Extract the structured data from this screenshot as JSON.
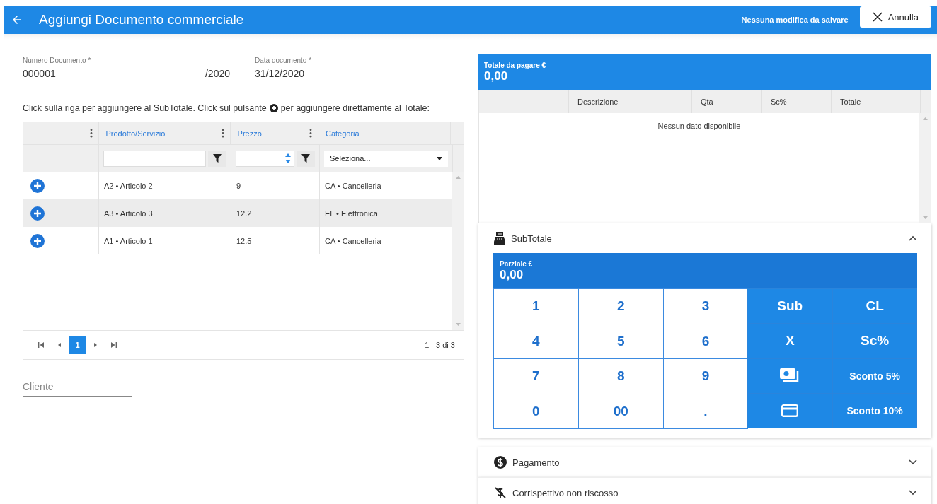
{
  "header": {
    "title": "Aggiungi Documento commerciale",
    "status": "Nessuna modifica da salvare",
    "cancel_button": "Annulla"
  },
  "fields": {
    "document_number": {
      "label": "Numero Documento *",
      "value": "000001",
      "suffix": "/2020"
    },
    "document_date": {
      "label": "Data documento *",
      "value": "31/12/2020"
    }
  },
  "instruction": {
    "before": "Click sulla riga per aggiungere al SubTotale. Click sul pulsante",
    "after": "per aggiungere direttamente al Totale:"
  },
  "products_table": {
    "columns": [
      "Prodotto/Servizio",
      "Prezzo",
      "Categoria"
    ],
    "category_filter_placeholder": "Seleziona...",
    "rows": [
      {
        "product": "A2 • Articolo 2",
        "price": "9",
        "category": "CA • Cancelleria",
        "selected": false
      },
      {
        "product": "A3 • Articolo 3",
        "price": "12.2",
        "category": "EL • Elettronica",
        "selected": true
      },
      {
        "product": "A1 • Articolo 1",
        "price": "12.5",
        "category": "CA • Cancelleria",
        "selected": false
      }
    ],
    "pages": [
      {
        "label": "1",
        "selected": true
      }
    ],
    "range": "1 - 3 di 3"
  },
  "customer_field": {
    "placeholder": "Cliente"
  },
  "total": {
    "label": "Totale da pagare €",
    "value": "0,00"
  },
  "receipt_table": {
    "columns": [
      "Descrizione",
      "Qta",
      "Sc%",
      "Totale"
    ],
    "empty_message": "Nessun dato disponibile"
  },
  "sections": [
    {
      "title": "SubTotale",
      "expanded": true
    },
    {
      "title": "Pagamento",
      "expanded": false
    },
    {
      "title": "Corrispettivo non riscosso",
      "expanded": false
    }
  ],
  "keypad": {
    "label": "Parziale €",
    "value": "0,00",
    "keys": [
      {
        "label": "1",
        "kind": "digit"
      },
      {
        "label": "2",
        "kind": "digit"
      },
      {
        "label": "3",
        "kind": "digit"
      },
      {
        "label": "Sub",
        "kind": "action"
      },
      {
        "label": "CL",
        "kind": "action"
      },
      {
        "label": "4",
        "kind": "digit"
      },
      {
        "label": "5",
        "kind": "digit"
      },
      {
        "label": "6",
        "kind": "digit"
      },
      {
        "label": "X",
        "kind": "action"
      },
      {
        "label": "Sc%",
        "kind": "action"
      },
      {
        "label": "7",
        "kind": "digit"
      },
      {
        "label": "8",
        "kind": "digit"
      },
      {
        "label": "9",
        "kind": "digit"
      },
      {
        "kind": "cash"
      },
      {
        "label": "Sconto 5%",
        "kind": "discount"
      },
      {
        "label": "0",
        "kind": "digit"
      },
      {
        "label": "00",
        "kind": "digit"
      },
      {
        "label": ".",
        "kind": "digit"
      },
      {
        "kind": "card"
      },
      {
        "label": "Sconto 10%",
        "kind": "discount"
      }
    ]
  }
}
